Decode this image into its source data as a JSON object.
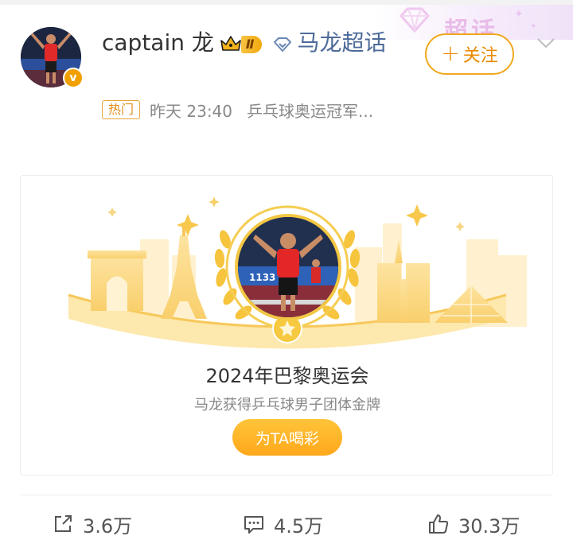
{
  "post": {
    "author": {
      "name": "captain 龙",
      "level_badge": "Ⅱ",
      "verified_mark": "v"
    },
    "topic_link": "马龙超话",
    "hot_tag": "热门",
    "time": "昨天 23:40",
    "source": "乒乓球奥运冠军...",
    "follow_label": "关注",
    "follow_plus": "+",
    "watermark_text": "超话"
  },
  "card": {
    "title": "2024年巴黎奥运会",
    "subtitle": "马龙获得乒乓球男子团体金牌",
    "cheer_label": "为TA喝彩",
    "photo_banner_text": "1133"
  },
  "actions": {
    "share_count": "3.6万",
    "comment_count": "4.5万",
    "like_count": "30.3万"
  },
  "colors": {
    "accent": "#f0a81e",
    "topic_link": "#4d6b9a",
    "gold": "#f3c744"
  }
}
